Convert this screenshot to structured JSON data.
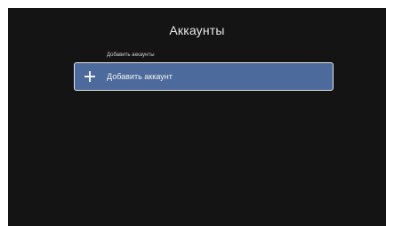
{
  "page": {
    "title": "Аккаунты"
  },
  "accounts_section": {
    "label": "Добавить аккаунты",
    "add_account": {
      "label": "Добавить аккаунт",
      "icon": "plus-icon"
    }
  },
  "colors": {
    "background": "#141414",
    "selected_row": "#4c6a9b",
    "row_border": "#e6e6e6",
    "text": "#e8e8e8"
  }
}
